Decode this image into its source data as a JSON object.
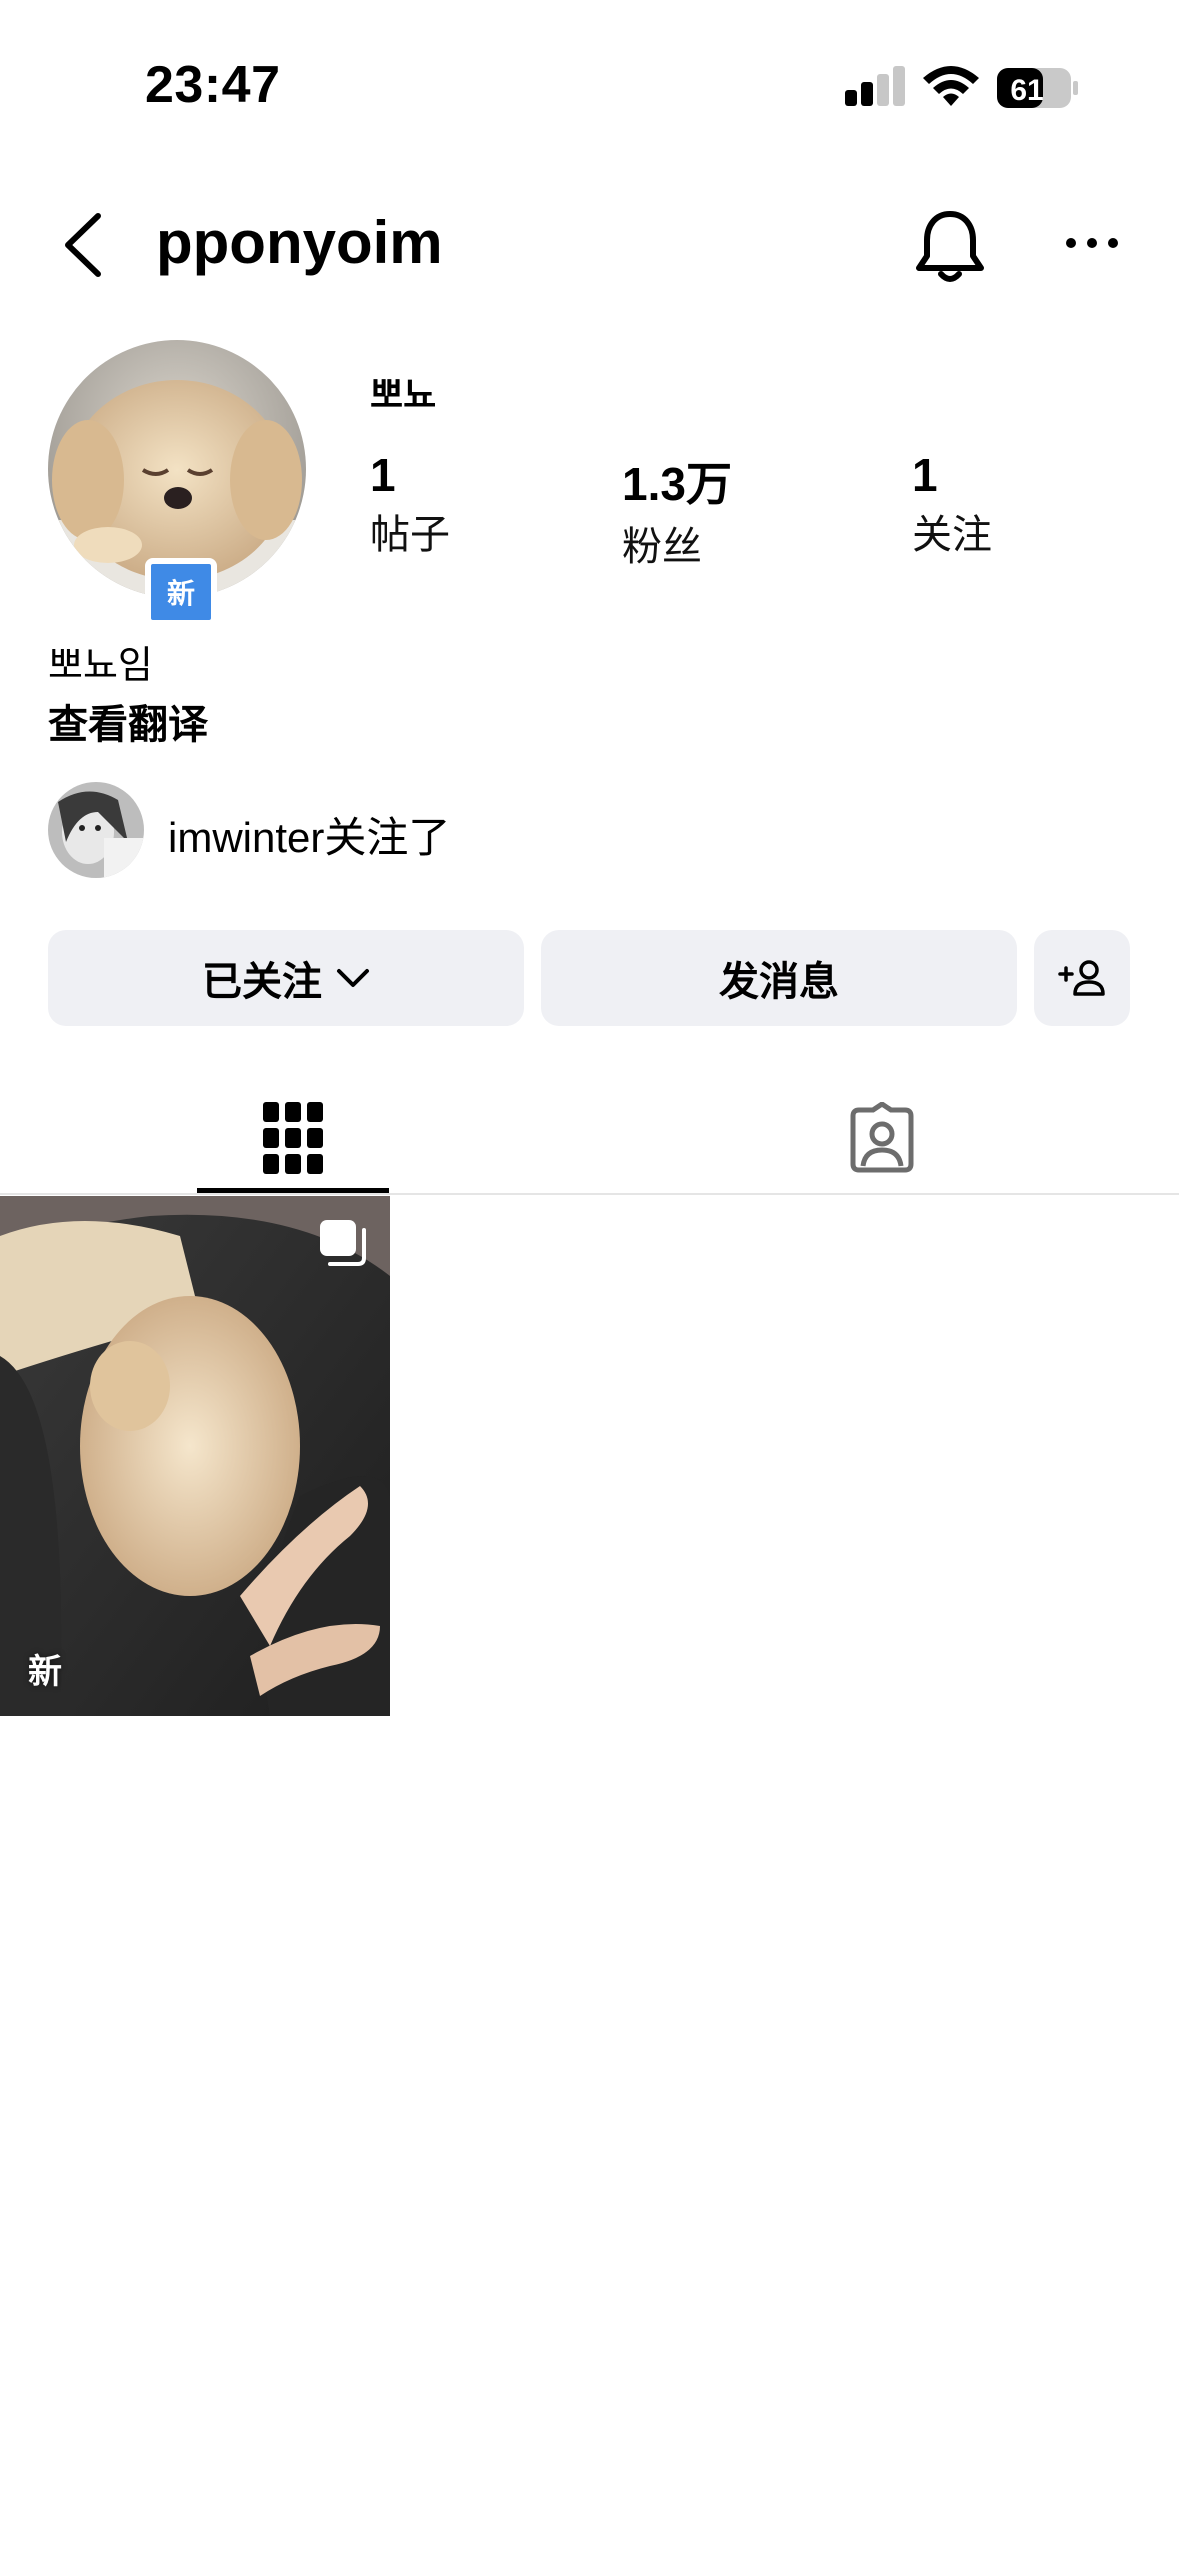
{
  "status_bar": {
    "time": "23:47",
    "battery": "61"
  },
  "header": {
    "username": "pponyoim",
    "icons": [
      "back-icon",
      "bell-icon",
      "more-icon"
    ]
  },
  "profile": {
    "display_name_small": "뽀뇨",
    "avatar_badge": "新",
    "stats": [
      {
        "value": "1",
        "label": "帖子"
      },
      {
        "value": "1.3万",
        "label": "粉丝"
      },
      {
        "value": "1",
        "label": "关注"
      }
    ],
    "full_name": "뽀뇨임",
    "translate_label": "查看翻译",
    "followed_by": {
      "user": "imwinter",
      "suffix": "关注了"
    }
  },
  "actions": {
    "following_label": "已关注",
    "message_label": "发消息"
  },
  "tabs": {
    "icons": [
      "grid-icon",
      "tagged-icon"
    ],
    "active": 0
  },
  "posts": [
    {
      "badge": "新"
    }
  ],
  "colors": {
    "accent_badge": "#3f8ae6",
    "button_bg": "#eff0f4"
  }
}
